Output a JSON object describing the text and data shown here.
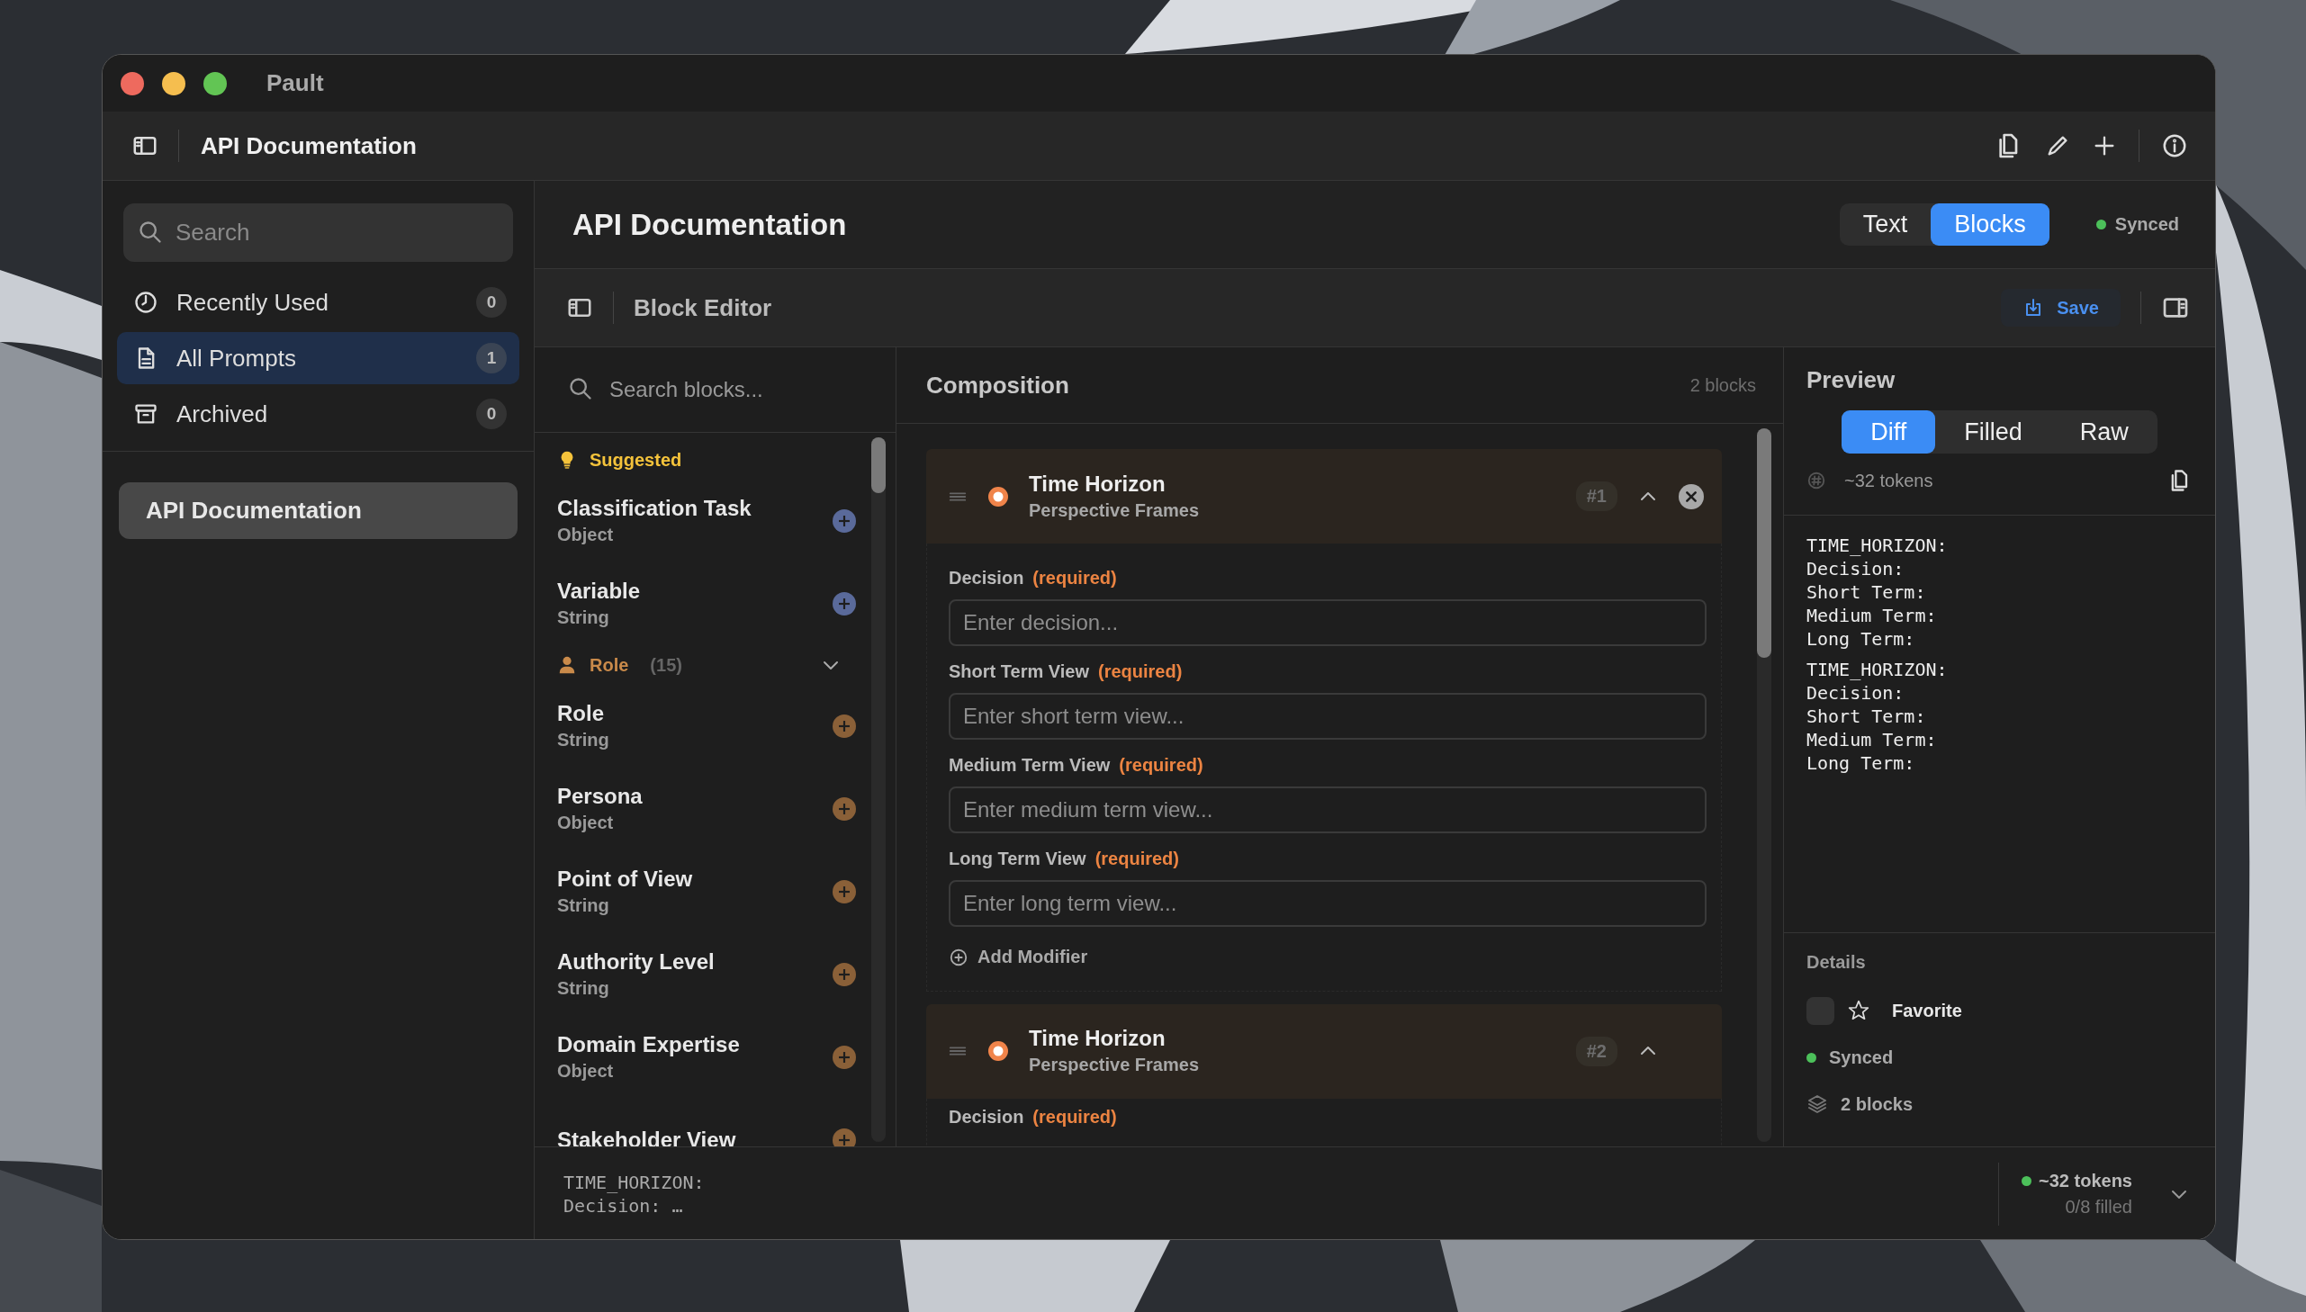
{
  "window": {
    "title": "Pault"
  },
  "toolbar": {
    "title": "API Documentation"
  },
  "sidebar": {
    "search": {
      "placeholder": "Search"
    },
    "items": [
      {
        "label": "Recently Used",
        "count": "0",
        "kind": "recent",
        "selected": false
      },
      {
        "label": "All Prompts",
        "count": "1",
        "kind": "all",
        "selected": true
      },
      {
        "label": "Archived",
        "count": "0",
        "kind": "archive",
        "selected": false
      }
    ],
    "prompts": [
      {
        "label": "API Documentation",
        "selected": true
      }
    ]
  },
  "header": {
    "title": "API Documentation",
    "modes": [
      {
        "label": "Text",
        "selected": false
      },
      {
        "label": "Blocks",
        "selected": true
      }
    ],
    "status": {
      "label": "Synced",
      "color": "#4cc05a"
    }
  },
  "editor": {
    "title": "Block Editor",
    "save": "Save"
  },
  "library": {
    "search": {
      "placeholder": "Search blocks..."
    },
    "groups": [
      {
        "kind": "suggested",
        "label": "Suggested",
        "items": [
          {
            "title": "Classification Task",
            "type": "Object"
          },
          {
            "title": "Variable",
            "type": "String"
          }
        ]
      },
      {
        "kind": "role",
        "label": "Role",
        "count": "(15)",
        "expanded": true,
        "items": [
          {
            "title": "Role",
            "type": "String"
          },
          {
            "title": "Persona",
            "type": "Object"
          },
          {
            "title": "Point of View",
            "type": "String"
          },
          {
            "title": "Authority Level",
            "type": "String"
          },
          {
            "title": "Domain Expertise",
            "type": "Object"
          },
          {
            "title": "Stakeholder View"
          }
        ]
      }
    ]
  },
  "composition": {
    "title": "Composition",
    "count": "2 blocks",
    "blocks": [
      {
        "title": "Time Horizon",
        "subtitle": "Perspective Frames",
        "badge": "#1",
        "expanded": true,
        "removable": true,
        "fields": [
          {
            "label": "Decision",
            "note": "(required)",
            "placeholder": "Enter decision..."
          },
          {
            "label": "Short Term View",
            "note": "(required)",
            "placeholder": "Enter short term view..."
          },
          {
            "label": "Medium Term View",
            "note": "(required)",
            "placeholder": "Enter medium term view..."
          },
          {
            "label": "Long Term View",
            "note": "(required)",
            "placeholder": "Enter long term view..."
          }
        ],
        "add_modifier": "Add Modifier"
      },
      {
        "title": "Time Horizon",
        "subtitle": "Perspective Frames",
        "badge": "#2",
        "expanded": true,
        "removable": false,
        "fields": [
          {
            "label": "Decision",
            "note": "(required)"
          }
        ]
      }
    ]
  },
  "preview": {
    "title": "Preview",
    "modes": [
      {
        "label": "Diff",
        "selected": true
      },
      {
        "label": "Filled",
        "selected": false
      },
      {
        "label": "Raw",
        "selected": false
      }
    ],
    "tokens": "~32 tokens",
    "output": [
      "TIME_HORIZON:\nDecision:\nShort Term:\nMedium Term:\nLong Term:",
      "TIME_HORIZON:\nDecision:\nShort Term:\nMedium Term:\nLong Term:"
    ],
    "details": {
      "title": "Details",
      "favorite": {
        "label": "Favorite",
        "checked": false
      },
      "status": {
        "label": "Synced",
        "color": "#4cc05a"
      },
      "blocks": "2 blocks"
    }
  },
  "footer": {
    "preview": "TIME_HORIZON:\nDecision: …",
    "tokens": "~32 tokens",
    "color": "#4cc05a",
    "filled": "0/8 filled"
  }
}
